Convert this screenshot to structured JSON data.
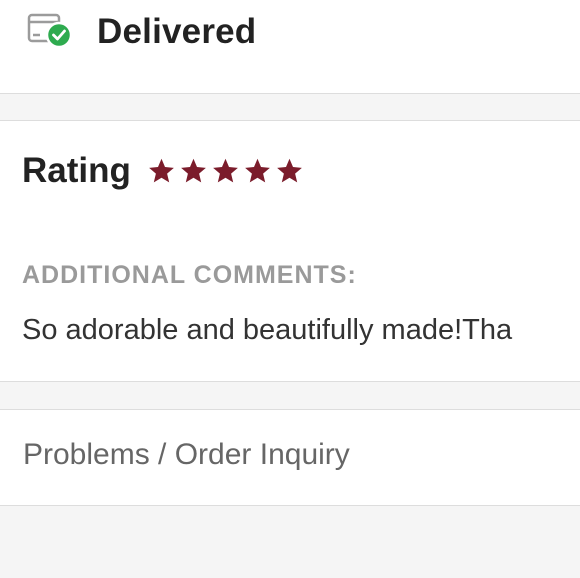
{
  "status": {
    "icon": "delivered-package-icon",
    "text": "Delivered",
    "check_color": "#2eab4f"
  },
  "review": {
    "rating_label": "Rating",
    "rating_value": 5,
    "rating_max": 5,
    "star_color": "#7b1c2b",
    "comments_label": "ADDITIONAL COMMENTS:",
    "comments_text": "So adorable and beautifully made!Tha"
  },
  "inquiry": {
    "label": "Problems / Order Inquiry"
  }
}
